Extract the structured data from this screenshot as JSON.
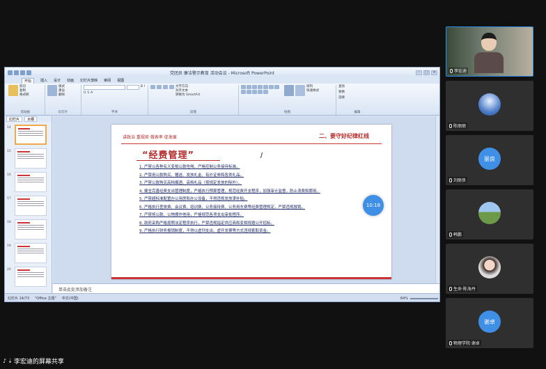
{
  "window": {
    "title": "党团员 廉洁警示教育 活动会议 - Microsoft PowerPoint",
    "tabs": [
      "开始",
      "插入",
      "设计",
      "动画",
      "幻灯片放映",
      "审阅",
      "视图"
    ]
  },
  "ribbon": {
    "groups": [
      {
        "label": "剪贴板",
        "items": [
          "粘贴",
          "剪切",
          "复制",
          "格式刷"
        ]
      },
      {
        "label": "幻灯片",
        "items": [
          "新建幻灯片",
          "版式",
          "重设",
          "删除"
        ]
      },
      {
        "label": "字体",
        "items": [
          "B",
          "I",
          "U",
          "S",
          "A"
        ]
      },
      {
        "label": "段落",
        "items": [
          "文字方向",
          "对齐文本",
          "转换为 SmartArt"
        ]
      },
      {
        "label": "绘图",
        "items": [
          "排列",
          "快速样式"
        ]
      },
      {
        "label": "编辑",
        "items": [
          "查找",
          "替换",
          "选择"
        ]
      }
    ]
  },
  "left_pane": {
    "tabs": [
      "幻灯片",
      "大纲"
    ],
    "thumb_numbers": [
      "14",
      "15",
      "16",
      "17",
      "18",
      "19",
      "20"
    ]
  },
  "slide": {
    "top_left": "讲政治 重规矩 做表率 促发展",
    "top_right": "二、要守好纪律红线",
    "heading": "“经费管理”",
    "items": [
      "1. 严禁以各种名义变相公款吃喝，严格控制公务接待标准。",
      "2. 严禁用公款购买、赠送、发放礼金、有价证券和各类礼品。",
      "3. 严禁公款购买高档烟酒、高档礼品（按规定发放的除外）。",
      "4. 健全完善经费支出管理制度，严格执行预算管理，规范经费开支程序，加强审计监督，防止浪费和挪用。",
      "5. 严禁超标准配置办公用房和办公设备，不得违规发放津补贴。",
      "6. 严格执行差旅费、会议费、培训费、公务接待费、公务用车费等经费管理规定，严禁违规报销。",
      "7. 严禁将公款、公物挪作他用，严格规范各项支出审批程序。",
      "8. 政府采购严格按照法定程序执行，严禁违规指定供应商和变相规避公开招标。",
      "9. 严格执行财务报销制度，不得以虚列支出、虚开发票等方式违规套取资金。"
    ]
  },
  "notes_placeholder": "单击此处添加备注",
  "status": {
    "slide_info": "幻灯片 14/73",
    "theme": "\"Office 主题\"",
    "language": "中文(中国)",
    "zoom": "64%"
  },
  "time_bubble": "10:18",
  "participants": [
    {
      "name": "李宏迪",
      "type": "video"
    },
    {
      "name": "陈丽丽",
      "type": "image-blue"
    },
    {
      "name": "刘丽良",
      "avatar_text": "丽良",
      "avatar_color": "#3f8fe6"
    },
    {
      "name": "韩鹏",
      "type": "image-landscape"
    },
    {
      "name": "生命·陈海丹",
      "type": "image-girl"
    },
    {
      "name": "物理学院·谢卓",
      "avatar_text": "谢卓",
      "avatar_color": "#3f8fe6"
    }
  ],
  "bottom_bar": "李宏迪的屏幕共享"
}
